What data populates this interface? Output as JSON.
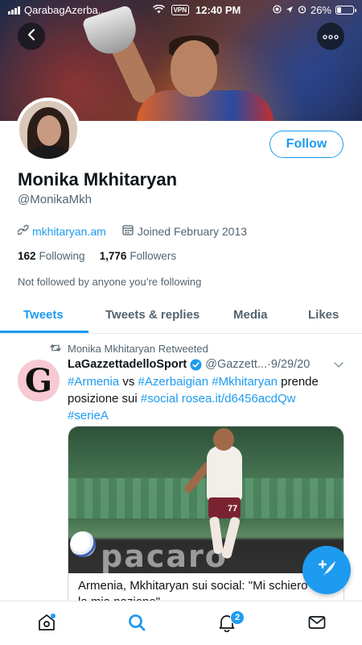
{
  "status_bar": {
    "carrier": "QarabagAzerba...",
    "vpn": "VPN",
    "time": "12:40 PM",
    "battery": "26%",
    "battery_level": 0.26
  },
  "profile": {
    "display_name": "Monika Mkhitaryan",
    "handle": "@MonikaMkh",
    "website": "mkhitaryan.am",
    "joined": "Joined February 2013",
    "following_count": "162",
    "following_label": "Following",
    "followers_count": "1,776",
    "followers_label": "Followers",
    "not_followed": "Not followed by anyone you’re following",
    "follow_label": "Follow"
  },
  "tabs": [
    {
      "label": "Tweets",
      "active": true
    },
    {
      "label": "Tweets & replies",
      "active": false
    },
    {
      "label": "Media",
      "active": false
    },
    {
      "label": "Likes",
      "active": false
    }
  ],
  "tweet": {
    "retweet_label": "Monika Mkhitaryan Retweeted",
    "avatar_letter": "G",
    "author_name": "LaGazzettadelloSport",
    "author_handle": "@Gazzett...",
    "separator": " · ",
    "date": "9/29/20",
    "text": {
      "tag_armenia": "#Armenia",
      "vs": " vs ",
      "tag_azerbaigian": "#Azerbaigian",
      "space1": " ",
      "tag_mkhitaryan": "#Mkhitaryan",
      "prende": " prende posizione sui ",
      "tag_social": "#social",
      "space2": " ",
      "link": "rosea.it/d6456acdQw",
      "tag_seriea": "#serieA"
    },
    "card_caption": "Armenia, Mkhitaryan sui social: \"Mi schiero con la mia nazione\"",
    "ad_board_text": "pacaro",
    "player_number": "77"
  },
  "bottom_nav": {
    "notifications_badge": "2"
  },
  "icons": {
    "back": "chevron-left-icon",
    "more": "more-dots-icon",
    "link": "link-icon",
    "calendar": "calendar-icon",
    "retweet": "retweet-icon",
    "verified": "verified-badge-icon",
    "chevron": "chevron-down-icon",
    "compose": "compose-tweet-icon",
    "home": "home-icon",
    "search": "search-icon",
    "notifications": "bell-icon",
    "messages": "mail-icon"
  },
  "colors": {
    "accent": "#1d9bf0",
    "text": "#0f1419",
    "muted": "#536471"
  }
}
